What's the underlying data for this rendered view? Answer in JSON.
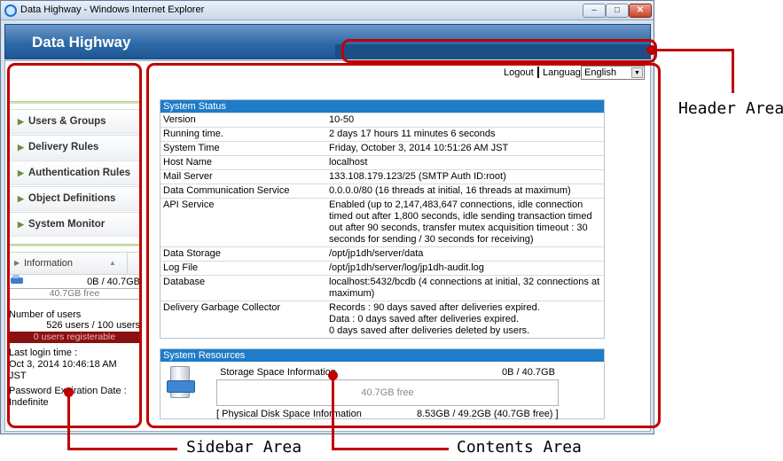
{
  "window": {
    "title": "Data Highway - Windows Internet Explorer",
    "minimize": "–",
    "maximize": "□",
    "close": "✕"
  },
  "header": {
    "app_title": "Data Highway"
  },
  "topbar": {
    "logout": "Logout",
    "language_label": "Language",
    "language_value": "English"
  },
  "sidebar": {
    "items": [
      {
        "label": "Users & Groups"
      },
      {
        "label": "Delivery Rules"
      },
      {
        "label": "Authentication Rules"
      },
      {
        "label": "Object Definitions"
      },
      {
        "label": "System Monitor"
      }
    ],
    "info": {
      "title": "Information",
      "usage": "0B / 40.7GB",
      "free": "40.7GB free",
      "users_label": "Number of users",
      "users_count": "526 users / 100 users",
      "users_registerable": "0 users registerable",
      "last_login_label": "Last login time :",
      "last_login_value1": "Oct 3, 2014 10:46:18 AM",
      "last_login_value2": "JST",
      "password_label": "Password Expiration Date :",
      "password_value": "Indefinite"
    }
  },
  "system_status": {
    "title": "System Status",
    "rows": [
      {
        "key": "Version",
        "value": "10-50"
      },
      {
        "key": "Running time.",
        "value": "2 days 17 hours 11 minutes 6 seconds"
      },
      {
        "key": "System Time",
        "value": "Friday, October 3, 2014 10:51:26 AM JST"
      },
      {
        "key": "Host Name",
        "value": "localhost"
      },
      {
        "key": "Mail Server",
        "value": "133.108.179.123/25 (SMTP Auth ID:root)"
      },
      {
        "key": "Data Communication Service",
        "value": "0.0.0.0/80 (16 threads at initial, 16 threads at maximum)"
      },
      {
        "key": "API Service",
        "value": "Enabled (up to 2,147,483,647 connections, idle connection timed out after 1,800 seconds, idle sending transaction timed out after 90 seconds, transfer mutex acquisition timeout : 30 seconds for sending / 30 seconds for receiving)"
      },
      {
        "key": "Data Storage",
        "value": "/opt/jp1dh/server/data"
      },
      {
        "key": "Log File",
        "value": "/opt/jp1dh/server/log/jp1dh-audit.log"
      },
      {
        "key": "Database",
        "value": "localhost:5432/bcdb (4 connections at initial, 32 connections at maximum)"
      },
      {
        "key": "Delivery Garbage Collector",
        "value": "Records : 90 days saved after deliveries expired.\nData : 0 days saved after deliveries expired.\n0 days saved after deliveries deleted by users."
      }
    ]
  },
  "system_resources": {
    "title": "System Resources",
    "storage_label": "Storage Space Information",
    "storage_used": "0B / 40.7GB",
    "storage_free": "40.7GB free",
    "physical_label": "[ Physical Disk Space Information",
    "physical_value": "8.53GB / 49.2GB (40.7GB free) ]"
  },
  "annotations": {
    "header": "Header Area",
    "sidebar": "Sidebar Area",
    "contents": "Contents Area"
  }
}
